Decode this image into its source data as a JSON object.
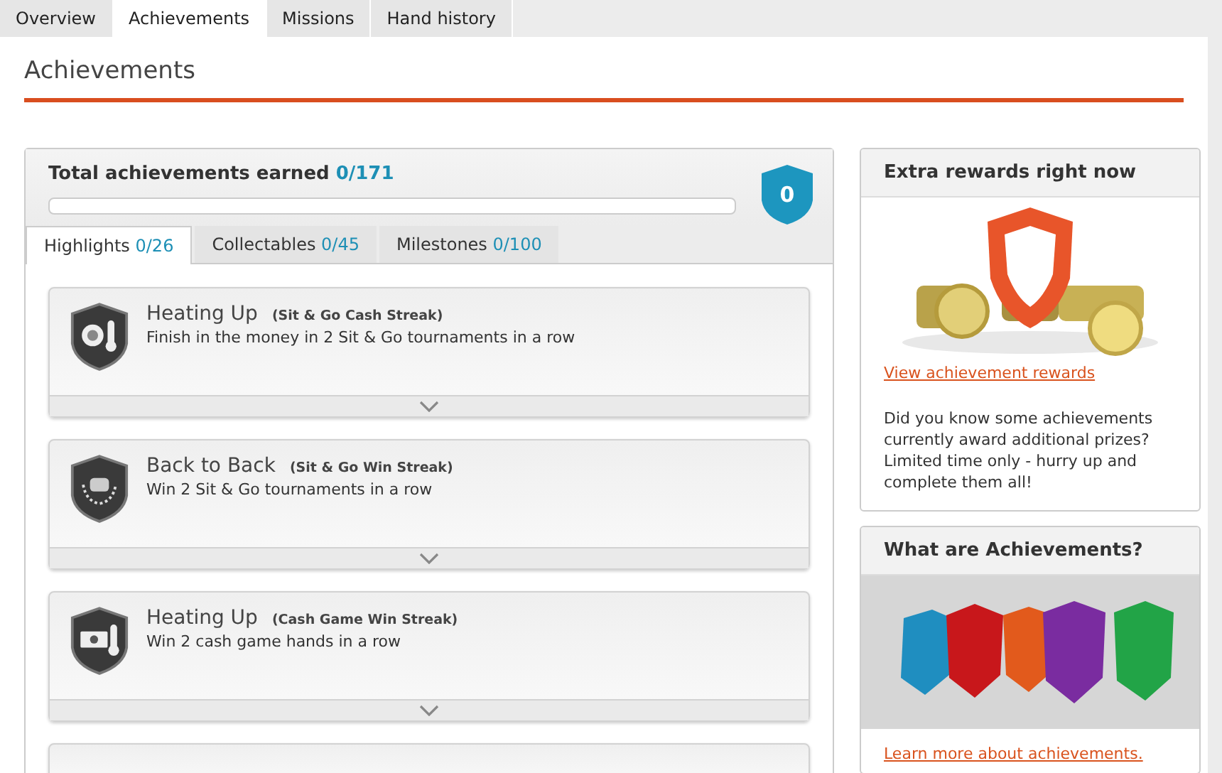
{
  "tabs": [
    {
      "label": "Overview",
      "selected": false
    },
    {
      "label": "Achievements",
      "selected": true
    },
    {
      "label": "Missions",
      "selected": false
    },
    {
      "label": "Hand history",
      "selected": false
    }
  ],
  "page_title": "Achievements",
  "summary": {
    "label": "Total achievements earned",
    "count": "0/171",
    "level": 0,
    "badge": "0"
  },
  "sub_tabs": [
    {
      "label": "Highlights",
      "count": "0/26",
      "selected": true
    },
    {
      "label": "Collectables",
      "count": "0/45",
      "selected": false
    },
    {
      "label": "Milestones",
      "count": "0/100",
      "selected": false
    }
  ],
  "achievements": [
    {
      "kind": "cash-streak",
      "title": "Heating Up",
      "subtitle": "(Sit & Go Cash Streak)",
      "description": "Finish in the money in 2 Sit & Go tournaments in a row"
    },
    {
      "kind": "win-streak",
      "title": "Back to Back",
      "subtitle": "(Sit & Go Win Streak)",
      "description": "Win 2 Sit & Go tournaments in a row"
    },
    {
      "kind": "cash-game",
      "title": "Heating Up",
      "subtitle": "(Cash Game Win Streak)",
      "description": "Win 2 cash game hands in a row"
    }
  ],
  "rewards_panel": {
    "title": "Extra rewards right now",
    "link": "View achievement rewards",
    "text": "Did you know some achievements currently award additional prizes? Limited time only - hurry up and complete them all!"
  },
  "about_panel": {
    "title": "What are Achievements?",
    "link": "Learn more about achievements."
  }
}
